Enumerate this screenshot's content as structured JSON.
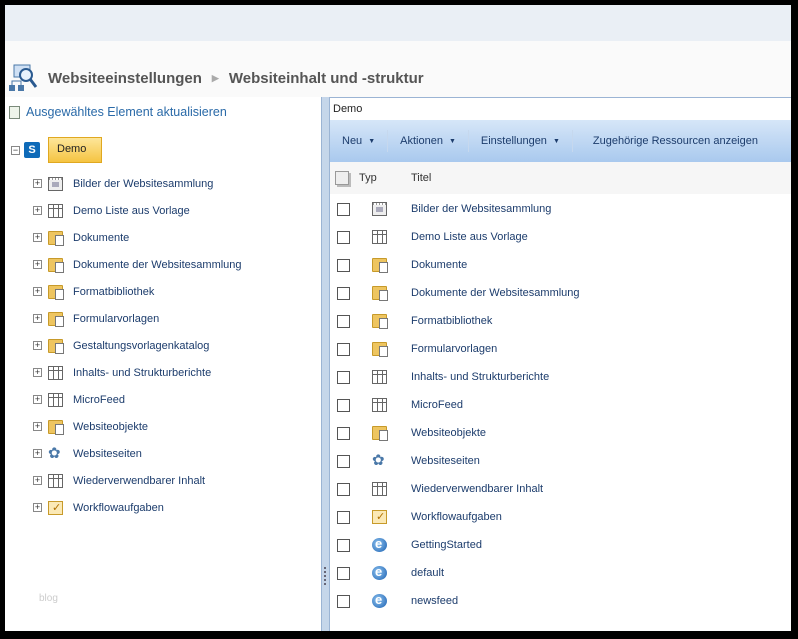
{
  "header": {
    "title": "Websiteeinstellungen",
    "subtitle": "Websiteinhalt und -struktur"
  },
  "left": {
    "refresh_label": "Ausgewähltes Element aktualisieren",
    "root": "Demo",
    "watermark": "blog",
    "items": [
      {
        "label": "Bilder der Websitesammlung",
        "icon": "image"
      },
      {
        "label": "Demo Liste aus Vorlage",
        "icon": "list"
      },
      {
        "label": "Dokumente",
        "icon": "folder"
      },
      {
        "label": "Dokumente der Websitesammlung",
        "icon": "folder"
      },
      {
        "label": "Formatbibliothek",
        "icon": "folder"
      },
      {
        "label": "Formularvorlagen",
        "icon": "folder"
      },
      {
        "label": "Gestaltungsvorlagenkatalog",
        "icon": "folder"
      },
      {
        "label": "Inhalts- und Strukturberichte",
        "icon": "list"
      },
      {
        "label": "MicroFeed",
        "icon": "list"
      },
      {
        "label": "Websiteobjekte",
        "icon": "folder"
      },
      {
        "label": "Websiteseiten",
        "icon": "site"
      },
      {
        "label": "Wiederverwendbarer Inhalt",
        "icon": "list"
      },
      {
        "label": "Workflowaufgaben",
        "icon": "task"
      }
    ]
  },
  "right": {
    "breadcrumb": "Demo",
    "toolbar": {
      "new": "Neu",
      "actions": "Aktionen",
      "settings": "Einstellungen",
      "related": "Zugehörige Ressourcen anzeigen"
    },
    "columns": {
      "type": "Typ",
      "title": "Titel"
    },
    "rows": [
      {
        "title": "Bilder der Websitesammlung",
        "icon": "image"
      },
      {
        "title": "Demo Liste aus Vorlage",
        "icon": "list"
      },
      {
        "title": "Dokumente",
        "icon": "folder"
      },
      {
        "title": "Dokumente der Websitesammlung",
        "icon": "folder"
      },
      {
        "title": "Formatbibliothek",
        "icon": "folder"
      },
      {
        "title": "Formularvorlagen",
        "icon": "folder"
      },
      {
        "title": "Inhalts- und Strukturberichte",
        "icon": "list"
      },
      {
        "title": "MicroFeed",
        "icon": "list"
      },
      {
        "title": "Websiteobjekte",
        "icon": "folder"
      },
      {
        "title": "Websiteseiten",
        "icon": "site"
      },
      {
        "title": "Wiederverwendbarer Inhalt",
        "icon": "list"
      },
      {
        "title": "Workflowaufgaben",
        "icon": "task"
      },
      {
        "title": "GettingStarted",
        "icon": "page"
      },
      {
        "title": "default",
        "icon": "page"
      },
      {
        "title": "newsfeed",
        "icon": "page"
      }
    ]
  }
}
